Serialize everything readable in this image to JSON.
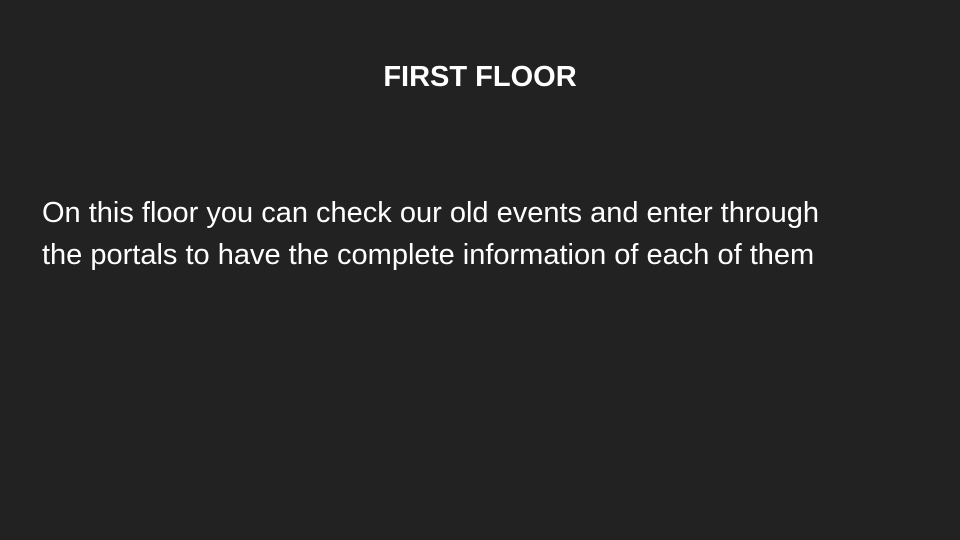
{
  "slide": {
    "title": "FIRST FLOOR",
    "body_lines": [
      "On this floor you can check our old events and enter through",
      "the portals to have the complete information of each of them"
    ],
    "colors": {
      "background": "#222222",
      "text": "#ffffff"
    }
  }
}
